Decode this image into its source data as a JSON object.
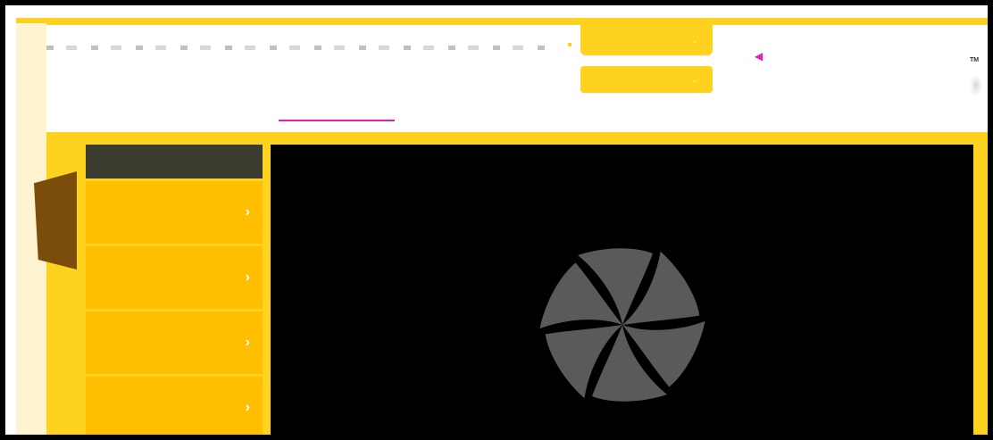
{
  "header": {
    "nav_text": "",
    "buttons": [
      {
        "label": "",
        "caret": "⌄"
      },
      {
        "label": "",
        "caret": "⌄"
      }
    ],
    "tm": "TM",
    "link_text": ""
  },
  "sidebar": {
    "header": "",
    "items": [
      {
        "label": "",
        "chevron": "›"
      },
      {
        "label": "",
        "chevron": "›"
      },
      {
        "label": "",
        "chevron": "›"
      },
      {
        "label": "",
        "chevron": "›"
      }
    ]
  },
  "icons": {
    "spinner": "loading-spinner-icon",
    "pink_arrow": "pointer-arrow-icon"
  },
  "colors": {
    "accent": "#ffd21f",
    "sidebar_item": "#ffbf00",
    "sidebar_header": "#3a3a2e",
    "brown_tab": "#7a4e0a",
    "link_pink": "#e21dc1",
    "stage_bg": "#000000",
    "spinner": "#5a5a5a"
  }
}
